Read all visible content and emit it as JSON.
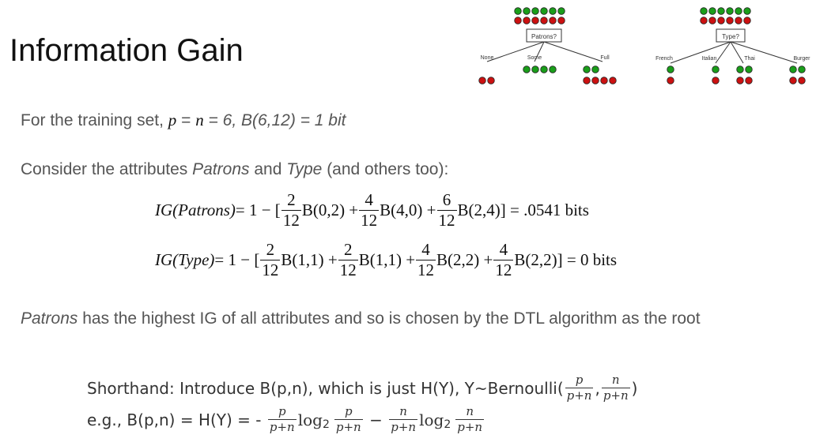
{
  "title": "Information Gain",
  "line1": {
    "prefix": "For the training set, ",
    "p": "p",
    "eq1": " = ",
    "n": "n",
    "eq2": " = 6,  ",
    "b": "B(6,12)",
    "suffix": " = 1 bit"
  },
  "line2": {
    "prefix": "Consider the attributes ",
    "attr1": "Patrons",
    "mid": " and ",
    "attr2": "Type",
    "suffix": " (and others too):"
  },
  "eq_patrons": {
    "lhs": "IG(Patrons)",
    "start": " = 1 − [",
    "f1n": "2",
    "f1d": "12",
    "t1": "B(0,2) + ",
    "f2n": "4",
    "f2d": "12",
    "t2": "B(4,0) + ",
    "f3n": "6",
    "f3d": "12",
    "t3": "B(2,4)] = .0541 bits"
  },
  "eq_type": {
    "lhs": "IG(Type)",
    "start": " = 1 − [",
    "f1n": "2",
    "f1d": "12",
    "t1": "B(1,1) + ",
    "f2n": "2",
    "f2d": "12",
    "t2": "B(1,1) + ",
    "f3n": "4",
    "f3d": "12",
    "t3": "B(2,2) + ",
    "f4n": "4",
    "f4d": "12",
    "t4": "B(2,2)] = 0 bits"
  },
  "line3": {
    "attr": "Patrons",
    "suffix": " has the highest IG of all attributes and so is chosen by the DTL algorithm as the root"
  },
  "shorthand": {
    "text": "Shorthand: Introduce B(p,n), which is just H(Y), Y~Bernoulli(",
    "f1n": "p",
    "f1d": "p+n",
    "comma": ",",
    "f2n": "n",
    "f2d": "p+n",
    "close": ")"
  },
  "example": {
    "text": "e.g., B(p,n) = H(Y) = - ",
    "f1n": "p",
    "f1d": "p+n",
    "log1": "log",
    "sub1": "2",
    "f2n": "p",
    "f2d": "p+n",
    "minus": " − ",
    "f3n": "n",
    "f3d": "p+n",
    "log2": "log",
    "sub2": "2",
    "f4n": "n",
    "f4d": "p+n"
  },
  "tree_patrons": {
    "root": "Patrons?",
    "branches": [
      "None",
      "Some",
      "Full"
    ]
  },
  "tree_type": {
    "root": "Type?",
    "branches": [
      "French",
      "Italian",
      "Thai",
      "Burger"
    ]
  },
  "colors": {
    "positive": "#1a9e1a",
    "negative": "#cc1111"
  }
}
